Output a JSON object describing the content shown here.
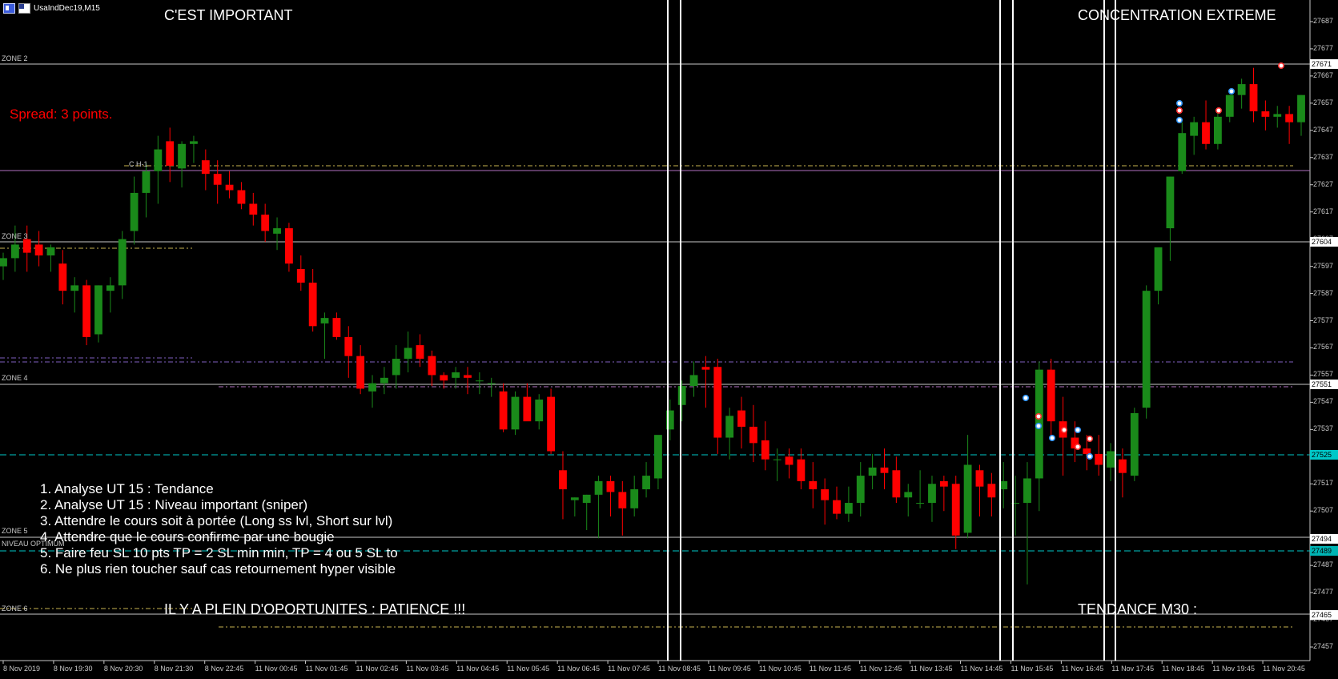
{
  "window": {
    "title": "UsaIndDec19,M15"
  },
  "headers": {
    "top_left": "C'EST IMPORTANT",
    "top_right": "CONCENTRATION EXTREME",
    "bottom_left": "IL Y A PLEIN D'OPORTUNITES : PATIENCE !!!",
    "bottom_right": "TENDANCE M30 :"
  },
  "spread_text": "Spread: 3 points.",
  "steps": [
    "1. Analyse UT 15 : Tendance",
    "2. Analyse UT 15 : Niveau important (sniper)",
    "3. Attendre le cours soit à portée (Long ss lvl, Short sur lvl)",
    "4. Attendre que le cours confirme par une bougie",
    "5. Faire feu SL 10 pts TP = 2 SL min min, TP = 4 ou 5 SL to",
    "6. Ne plus rien toucher sauf cas retournement hyper visible"
  ],
  "zones": {
    "zone2": "ZONE 2",
    "ch1": "C H-1",
    "zone3": "ZONE 3",
    "zone4": "ZONE 4",
    "zone5": "ZONE 5",
    "niveau": "NIVEAU OPTIMUM",
    "zone6": "ZONE 6"
  },
  "price_axis": {
    "ticks": [
      "27687",
      "27677",
      "27667",
      "27657",
      "27647",
      "27637",
      "27627",
      "27617",
      "27607",
      "27597",
      "27587",
      "27577",
      "27567",
      "27557",
      "27547",
      "27537",
      "27527",
      "27517",
      "27507",
      "27497",
      "27487",
      "27477",
      "27467",
      "27457"
    ],
    "tags": {
      "zone2": "27671",
      "zone3": "27604",
      "zone4": "27551",
      "cyan": "27525",
      "zone5": "27494",
      "teal": "27489",
      "zone6": "27465"
    }
  },
  "time_axis": {
    "ticks": [
      "8 Nov 2019",
      "8 Nov 19:30",
      "8 Nov 20:30",
      "8 Nov 21:30",
      "8 Nov 22:45",
      "11 Nov 00:45",
      "11 Nov 01:45",
      "11 Nov 02:45",
      "11 Nov 03:45",
      "11 Nov 04:45",
      "11 Nov 05:45",
      "11 Nov 06:45",
      "11 Nov 07:45",
      "11 Nov 08:45",
      "11 Nov 09:45",
      "11 Nov 10:45",
      "11 Nov 11:45",
      "11 Nov 12:45",
      "11 Nov 13:45",
      "11 Nov 14:45",
      "11 Nov 15:45",
      "11 Nov 16:45",
      "11 Nov 17:45",
      "11 Nov 18:45",
      "11 Nov 19:45",
      "11 Nov 20:45"
    ]
  },
  "colors": {
    "background": "#000000",
    "bull": "#1a8a1a",
    "bear": "#ff0000",
    "zone_line": "#c8c8c8",
    "ch_line": "#b070c0",
    "cyan_line": "#00c8c8",
    "dash_yellow": "#c8b450",
    "dash_violet": "#8060c0",
    "spread_text": "#ff0000"
  },
  "chart_data": {
    "type": "candlestick",
    "price_range": [
      27452,
      27692
    ],
    "candles": [
      [
        27597,
        27602,
        27592,
        27600
      ],
      [
        27600,
        27612,
        27595,
        27605
      ],
      [
        27607,
        27612,
        27595,
        27602
      ],
      [
        27605,
        27610,
        27597,
        27601
      ],
      [
        27601,
        27605,
        27595,
        27604
      ],
      [
        27598,
        27603,
        27583,
        27588
      ],
      [
        27588,
        27593,
        27580,
        27590
      ],
      [
        27590,
        27592,
        27568,
        27571
      ],
      [
        27572,
        27590,
        27569,
        27590
      ],
      [
        27588,
        27593,
        27580,
        27590
      ],
      [
        27590,
        27610,
        27585,
        27607
      ],
      [
        27610,
        27630,
        27605,
        27624
      ],
      [
        27624,
        27635,
        27615,
        27632
      ],
      [
        27632,
        27645,
        27620,
        27640
      ],
      [
        27643,
        27648,
        27628,
        27634
      ],
      [
        27633,
        27643,
        27626,
        27642
      ],
      [
        27642,
        27645,
        27635,
        27643
      ],
      [
        27636,
        27640,
        27625,
        27631
      ],
      [
        27631,
        27636,
        27620,
        27627
      ],
      [
        27627,
        27632,
        27622,
        27625
      ],
      [
        27625,
        27628,
        27618,
        27620
      ],
      [
        27620,
        27624,
        27612,
        27616
      ],
      [
        27616,
        27620,
        27606,
        27610
      ],
      [
        27609,
        27615,
        27603,
        27611
      ],
      [
        27611,
        27613,
        27595,
        27598
      ],
      [
        27596,
        27601,
        27588,
        27591
      ],
      [
        27591,
        27596,
        27573,
        27575
      ],
      [
        27576,
        27580,
        27563,
        27578
      ],
      [
        27578,
        27580,
        27570,
        27571
      ],
      [
        27571,
        27575,
        27556,
        27564
      ],
      [
        27564,
        27568,
        27550,
        27552
      ],
      [
        27551,
        27557,
        27545,
        27554
      ],
      [
        27554,
        27560,
        27550,
        27556
      ],
      [
        27557,
        27568,
        27552,
        27563
      ],
      [
        27563,
        27573,
        27558,
        27567
      ],
      [
        27568,
        27572,
        27560,
        27563
      ],
      [
        27564,
        27566,
        27553,
        27557
      ],
      [
        27557,
        27558,
        27552,
        27555
      ],
      [
        27556,
        27560,
        27552,
        27558
      ],
      [
        27557,
        27560,
        27550,
        27556
      ],
      [
        27555,
        27558,
        27550,
        27555
      ],
      [
        27554,
        27556,
        27549,
        27554
      ],
      [
        27551,
        27554,
        27536,
        27537
      ],
      [
        27537,
        27551,
        27535,
        27549
      ],
      [
        27549,
        27554,
        27543,
        27540
      ],
      [
        27540,
        27550,
        27537,
        27548
      ],
      [
        27549,
        27552,
        27528,
        27529
      ],
      [
        27522,
        27529,
        27504,
        27515
      ],
      [
        27511,
        27512,
        27505,
        27512
      ],
      [
        27510,
        27513,
        27500,
        27513
      ],
      [
        27513,
        27520,
        27497,
        27518
      ],
      [
        27518,
        27520,
        27505,
        27514
      ],
      [
        27514,
        27518,
        27498,
        27508
      ],
      [
        27508,
        27520,
        27505,
        27515
      ],
      [
        27515,
        27525,
        27512,
        27520
      ],
      [
        27519,
        27530,
        27515,
        27535
      ],
      [
        27537,
        27548,
        27533,
        27544
      ],
      [
        27546,
        27555,
        27540,
        27553
      ],
      [
        27553,
        27562,
        27549,
        27557
      ],
      [
        27560,
        27564,
        27545,
        27559
      ],
      [
        27560,
        27563,
        27528,
        27534
      ],
      [
        27534,
        27545,
        27526,
        27542
      ],
      [
        27544,
        27549,
        27530,
        27538
      ],
      [
        27538,
        27546,
        27525,
        27532
      ],
      [
        27533,
        27540,
        27522,
        27526
      ],
      [
        27526,
        27530,
        27518,
        27526
      ],
      [
        27527,
        27530,
        27519,
        27524
      ],
      [
        27526,
        27530,
        27515,
        27518
      ],
      [
        27518,
        27525,
        27508,
        27515
      ],
      [
        27515,
        27519,
        27502,
        27511
      ],
      [
        27511,
        27516,
        27504,
        27506
      ],
      [
        27506,
        27516,
        27503,
        27510
      ],
      [
        27510,
        27525,
        27505,
        27520
      ],
      [
        27520,
        27528,
        27515,
        27523
      ],
      [
        27523,
        27530,
        27515,
        27521
      ],
      [
        27522,
        27527,
        27510,
        27512
      ],
      [
        27512,
        27517,
        27505,
        27514
      ],
      [
        27510,
        27522,
        27508,
        27510
      ],
      [
        27510,
        27520,
        27503,
        27517
      ],
      [
        27518,
        27520,
        27507,
        27516
      ],
      [
        27517,
        27520,
        27493,
        27498
      ],
      [
        27499,
        27535,
        27497,
        27524
      ],
      [
        27522,
        27524,
        27505,
        27516
      ],
      [
        27517,
        27521,
        27505,
        27512
      ],
      [
        27515,
        27525,
        27508,
        27518
      ],
      [
        27510,
        27520,
        27498,
        27510
      ],
      [
        27510,
        27525,
        27480,
        27519
      ],
      [
        27519,
        27562,
        27507,
        27559
      ],
      [
        27559,
        27563,
        27533,
        27540
      ],
      [
        27540,
        27549,
        27520,
        27534
      ],
      [
        27534,
        27540,
        27525,
        27530
      ],
      [
        27530,
        27535,
        27522,
        27528
      ],
      [
        27528,
        27535,
        27520,
        27524
      ],
      [
        27523,
        27532,
        27518,
        27529
      ],
      [
        27526,
        27530,
        27512,
        27521
      ],
      [
        27520,
        27545,
        27518,
        27543
      ],
      [
        27545,
        27590,
        27541,
        27588
      ],
      [
        27588,
        27600,
        27583,
        27604
      ],
      [
        27611,
        27630,
        27599,
        27630
      ],
      [
        27632,
        27650,
        27631,
        27646
      ],
      [
        27645,
        27652,
        27638,
        27650
      ],
      [
        27650,
        27658,
        27640,
        27642
      ],
      [
        27642,
        27655,
        27640,
        27652
      ],
      [
        27652,
        27660,
        27650,
        27660
      ],
      [
        27660,
        27666,
        27655,
        27664
      ],
      [
        27664,
        27670,
        27650,
        27654
      ],
      [
        27654,
        27658,
        27647,
        27652
      ],
      [
        27652,
        27656,
        27648,
        27653
      ],
      [
        27653,
        27656,
        27642,
        27650
      ],
      [
        27650,
        27660,
        27645,
        27660
      ]
    ]
  }
}
